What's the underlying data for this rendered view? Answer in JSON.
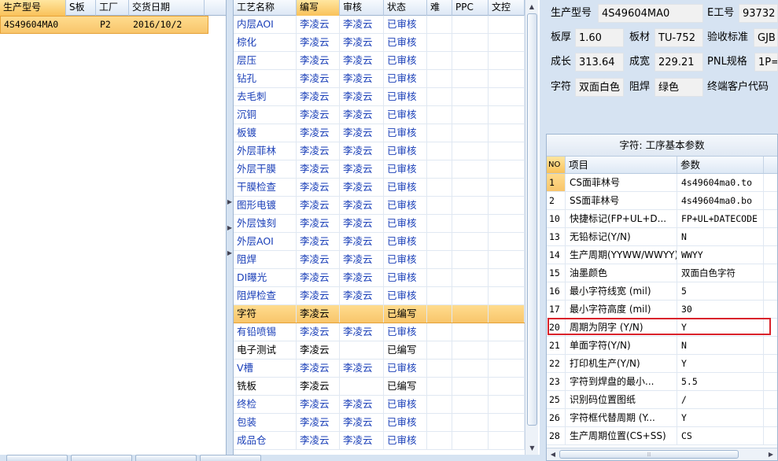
{
  "orders": {
    "headers": [
      "生产型号",
      "S板",
      "工厂",
      "交货日期"
    ],
    "rows": [
      {
        "model": "4S49604MA0",
        "sboard": "",
        "factory": "P2",
        "date": "2016/10/2"
      }
    ]
  },
  "processes": {
    "headers": [
      "工艺名称",
      "编写",
      "审核",
      "状态",
      "难",
      "PPC",
      "文控"
    ],
    "rows": [
      {
        "name": "内层AOI",
        "writer": "李凌云",
        "reviewer": "李凌云",
        "status": "已审核"
      },
      {
        "name": "棕化",
        "writer": "李凌云",
        "reviewer": "李凌云",
        "status": "已审核"
      },
      {
        "name": "层压",
        "writer": "李凌云",
        "reviewer": "李凌云",
        "status": "已审核"
      },
      {
        "name": "钻孔",
        "writer": "李凌云",
        "reviewer": "李凌云",
        "status": "已审核"
      },
      {
        "name": "去毛刺",
        "writer": "李凌云",
        "reviewer": "李凌云",
        "status": "已审核"
      },
      {
        "name": "沉铜",
        "writer": "李凌云",
        "reviewer": "李凌云",
        "status": "已审核"
      },
      {
        "name": "板镀",
        "writer": "李凌云",
        "reviewer": "李凌云",
        "status": "已审核"
      },
      {
        "name": "外层菲林",
        "writer": "李凌云",
        "reviewer": "李凌云",
        "status": "已审核"
      },
      {
        "name": "外层干膜",
        "writer": "李凌云",
        "reviewer": "李凌云",
        "status": "已审核"
      },
      {
        "name": "干膜检查",
        "writer": "李凌云",
        "reviewer": "李凌云",
        "status": "已审核"
      },
      {
        "name": "图形电镀",
        "writer": "李凌云",
        "reviewer": "李凌云",
        "status": "已审核"
      },
      {
        "name": "外层蚀刻",
        "writer": "李凌云",
        "reviewer": "李凌云",
        "status": "已审核"
      },
      {
        "name": "外层AOI",
        "writer": "李凌云",
        "reviewer": "李凌云",
        "status": "已审核"
      },
      {
        "name": "阻焊",
        "writer": "李凌云",
        "reviewer": "李凌云",
        "status": "已审核"
      },
      {
        "name": "DI曝光",
        "writer": "李凌云",
        "reviewer": "李凌云",
        "status": "已审核"
      },
      {
        "name": "阻焊检查",
        "writer": "李凌云",
        "reviewer": "李凌云",
        "status": "已审核"
      },
      {
        "name": "字符",
        "writer": "李凌云",
        "reviewer": "",
        "status": "已编写"
      },
      {
        "name": "有铅喷锡",
        "writer": "李凌云",
        "reviewer": "李凌云",
        "status": "已审核"
      },
      {
        "name": "电子测试",
        "writer": "李凌云",
        "reviewer": "",
        "status": "已编写"
      },
      {
        "name": "V槽",
        "writer": "李凌云",
        "reviewer": "李凌云",
        "status": "已审核"
      },
      {
        "name": "铣板",
        "writer": "李凌云",
        "reviewer": "",
        "status": "已编写"
      },
      {
        "name": "终检",
        "writer": "李凌云",
        "reviewer": "李凌云",
        "status": "已审核"
      },
      {
        "name": "包装",
        "writer": "李凌云",
        "reviewer": "李凌云",
        "status": "已审核"
      },
      {
        "name": "成品仓",
        "writer": "李凌云",
        "reviewer": "李凌云",
        "status": "已审核"
      }
    ]
  },
  "info": {
    "model_label": "生产型号",
    "model_value": "4S49604MA0",
    "eno_label": "E工号",
    "eno_value": "93732",
    "thickness_label": "板厚",
    "thickness_value": "1.60",
    "material_label": "板材",
    "material_value": "TU-752",
    "standard_label": "验收标准",
    "standard_value": "GJB",
    "length_label": "成长",
    "length_value": "313.64",
    "width_label": "成宽",
    "width_value": "229.21",
    "pnl_label": "PNL规格",
    "pnl_value": "1P=",
    "char_label": "字符",
    "char_value": "双面白色",
    "solder_label": "阻焊",
    "solder_value": "绿色",
    "customer_label": "终端客户代码"
  },
  "params": {
    "title": "字符: 工序基本参数",
    "headers": {
      "no": "NO",
      "item": "项目",
      "value": "参数"
    },
    "rows": [
      {
        "no": "1",
        "item": "CS面菲林号",
        "value": "4s49604ma0.to"
      },
      {
        "no": "2",
        "item": "SS面菲林号",
        "value": "4s49604ma0.bo"
      },
      {
        "no": "10",
        "item": "快捷标记(FP+UL+D...",
        "value": "FP+UL+DATECODE"
      },
      {
        "no": "13",
        "item": "无铅标记(Y/N)",
        "value": "N"
      },
      {
        "no": "14",
        "item": "生产周期(YYWW/WWYY)",
        "value": "WWYY"
      },
      {
        "no": "15",
        "item": "油墨颜色",
        "value": "双面白色字符"
      },
      {
        "no": "16",
        "item": "最小字符线宽 (mil)",
        "value": "5"
      },
      {
        "no": "17",
        "item": "最小字符高度 (mil)",
        "value": "30"
      },
      {
        "no": "20",
        "item": "周期为阴字 (Y/N)",
        "value": "Y"
      },
      {
        "no": "21",
        "item": "单面字符(Y/N)",
        "value": "N"
      },
      {
        "no": "22",
        "item": "打印机生产(Y/N)",
        "value": "Y"
      },
      {
        "no": "23",
        "item": "字符到焊盘的最小...",
        "value": "5.5"
      },
      {
        "no": "25",
        "item": "识别码位置图纸",
        "value": "/"
      },
      {
        "no": "26",
        "item": "字符框代替周期 (Y...",
        "value": "Y"
      },
      {
        "no": "28",
        "item": "生产周期位置(CS+SS)",
        "value": "CS"
      }
    ]
  },
  "colors": {
    "selection": "#f8c56b",
    "highlight_border": "#d9232b",
    "panel_bg": "#d6e3f2",
    "link_blue": "#1a3fb8"
  }
}
